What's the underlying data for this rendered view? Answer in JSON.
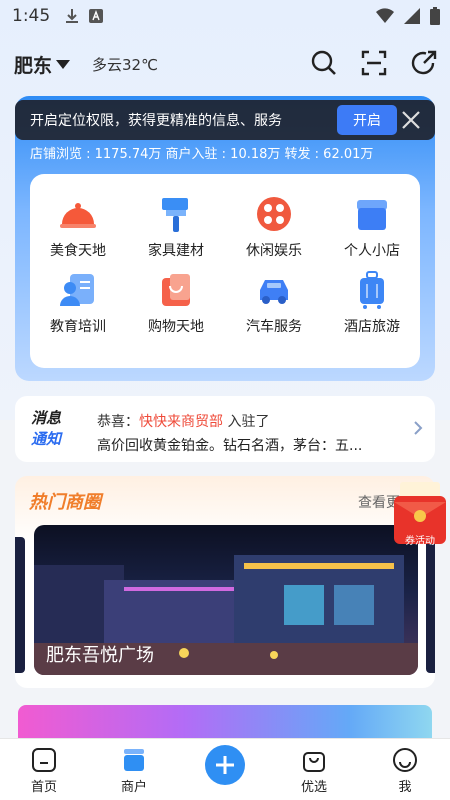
{
  "status_bar": {
    "time": "1:45"
  },
  "header": {
    "city": "肥东",
    "weather": "多云32℃"
  },
  "location_tip": {
    "text": "开启定位权限，获得更精准的信息、服务",
    "button": "开启"
  },
  "stats": {
    "text": "店铺浏览 : 1175.74万   商户入驻 : 10.18万   转发 : 62.01万"
  },
  "categories": [
    {
      "label": "美食天地",
      "icon": "food-cloche-icon",
      "color": "#f5593a"
    },
    {
      "label": "家具建材",
      "icon": "paint-roller-icon",
      "color": "#3a8ef5"
    },
    {
      "label": "休闲娱乐",
      "icon": "film-reel-icon",
      "color": "#f0593e"
    },
    {
      "label": "个人小店",
      "icon": "shop-icon",
      "color": "#3d7ef5"
    },
    {
      "label": "教育培训",
      "icon": "education-icon",
      "color": "#3d8bf5"
    },
    {
      "label": "购物天地",
      "icon": "shopping-bag-icon",
      "color": "#f5614a"
    },
    {
      "label": "汽车服务",
      "icon": "car-icon",
      "color": "#3f7ff5"
    },
    {
      "label": "酒店旅游",
      "icon": "luggage-icon",
      "color": "#3d86f5"
    }
  ],
  "notice": {
    "brand_line1": "消息",
    "brand_line2": "通知",
    "prefix": "恭喜：",
    "shop": "快快来商贸部",
    "suffix": " 入驻了",
    "line2": "高价回收黄金铂金。钻石名酒，茅台：五..."
  },
  "hot": {
    "title": "热门商圈",
    "more": "查看更",
    "photo_caption": "肥东吾悦广场",
    "coupon": "券活动"
  },
  "tabbar": {
    "home": "首页",
    "merchant": "商户",
    "featured": "优选",
    "me": "我"
  },
  "colors": {
    "accent": "#2f8ff3",
    "notice_shop": "#ef4b3a",
    "hot_title": "#f07e2b"
  }
}
